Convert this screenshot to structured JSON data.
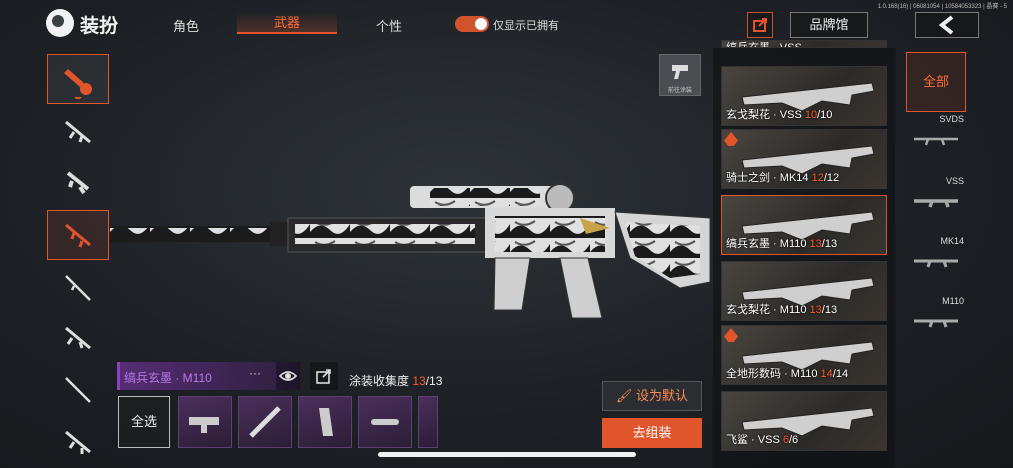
{
  "header": {
    "version": "1.0.168(16) | 06081054 | 10584053323 | 晶赛 - 5",
    "title": "装扮",
    "tabs": [
      {
        "label": "角色",
        "active": false
      },
      {
        "label": "武器",
        "active": true
      },
      {
        "label": "个性",
        "active": false
      }
    ],
    "owned_toggle": {
      "label": "仅显示已拥有",
      "on": true
    },
    "brand_button": "品牌馆"
  },
  "preview": {
    "coat_button": "前往涂装"
  },
  "skin_bar": {
    "name": "缟兵玄墨 · M110",
    "dots": "···",
    "collect_label": "涂装收集度",
    "collect_current": "13",
    "collect_total": "/13"
  },
  "parts": {
    "select_all": "全选"
  },
  "actions": {
    "set_default": "设为默认",
    "go_assemble": "去组装"
  },
  "skins": [
    {
      "name": "缟兵玄墨 · VSS",
      "count": "",
      "total": "",
      "fire": false,
      "active": false
    },
    {
      "name": "玄戈梨花 · VSS",
      "count": "10",
      "total": "/10",
      "fire": false,
      "active": false
    },
    {
      "name": "骑士之剑 · MK14",
      "count": "12",
      "total": "/12",
      "fire": true,
      "active": false
    },
    {
      "name": "缟兵玄墨 · M110",
      "count": "13",
      "total": "/13",
      "fire": false,
      "active": true
    },
    {
      "name": "玄戈梨花 · M110",
      "count": "13",
      "total": "/13",
      "fire": false,
      "active": false
    },
    {
      "name": "全地形数码 · M110",
      "count": "14",
      "total": "/14",
      "fire": true,
      "active": false
    },
    {
      "name": "飞鲨 · VSS",
      "count": "6",
      "total": "/6",
      "fire": false,
      "active": false
    }
  ],
  "categories": {
    "all": "全部",
    "items": [
      "SVDS",
      "VSS",
      "MK14",
      "M110"
    ]
  },
  "colors": {
    "accent": "#e2542a",
    "purple": "#8e3ec2"
  }
}
